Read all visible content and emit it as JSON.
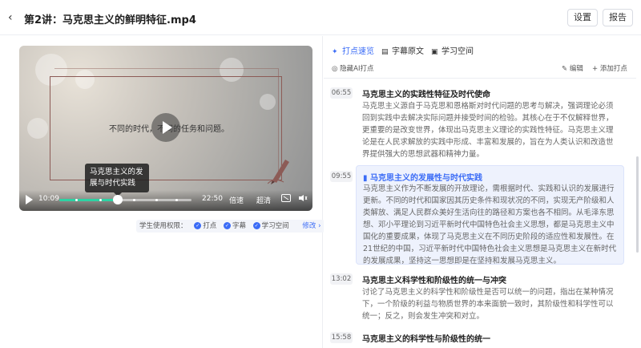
{
  "header": {
    "title": "第2讲：马克思主义的鲜明特征.mp4",
    "settings_label": "设置",
    "report_label": "报告"
  },
  "video": {
    "caption": "不同的时代，不同的任务和问题。",
    "tooltip": "马克思主义的发展与时代实践",
    "current_time": "10:09",
    "duration": "22:50",
    "speed_label": "倍速",
    "quality_label": "超清",
    "progress": 0.44
  },
  "permissions": {
    "label": "学生使用权限：",
    "items": [
      "打点",
      "字幕",
      "学习空间"
    ],
    "modify_label": "修改"
  },
  "tabs": [
    {
      "label": "打点速览",
      "icon": "sparkle-icon",
      "active": true
    },
    {
      "label": "字幕原文",
      "icon": "subtitle-icon",
      "active": false
    },
    {
      "label": "学习空间",
      "icon": "book-icon",
      "active": false
    }
  ],
  "subbar": {
    "hide_ai_label": "隐藏AI打点",
    "edit_label": "编辑",
    "add_label": "+ 添加打点"
  },
  "items": [
    {
      "time": "06:55",
      "title": "马克思主义的实践性特征及时代使命",
      "body": "马克思主义源自于马克思和恩格斯对时代问题的思考与解决，强调理论必须回到实践中去解决实际问题并接受时间的检验。其核心在于不仅解释世界，更重要的是改变世界，体现出马克思主义理论的实践性特征。马克思主义理论是在人民求解放的实践中形成、丰富和发展的，旨在为人类认识和改造世界提供强大的思想武器和精神力量。",
      "active": false
    },
    {
      "time": "09:55",
      "title": "马克思主义的发展性与时代实践",
      "body": "马克思主义作为不断发展的开放理论，需根据时代、实践和认识的发展进行更新。不同的时代和国家因其历史条件和现状况的不同，实现无产阶级和人类解放、满足人民群众美好生活向往的路径和方案也各不相同。从毛泽东思想、邓小平理论到习近平新时代中国特色社会主义思想，都是马克思主义中国化的重要成果，体现了马克思主义在不同历史阶段的适应性和发展性。在21世纪的中国，习近平新时代中国特色社会主义思想是马克思主义在新时代的发展成果，坚持这一思想即是在坚持和发展马克思主义。",
      "active": true
    },
    {
      "time": "13:02",
      "title": "马克思主义科学性和阶级性的统一与冲突",
      "body": "讨论了马克思主义的科学性和阶级性是否可以统一的问题，指出在某种情况下，一个阶级的利益与物质世界的本来面貌一致时，其阶级性和科学性可以统一；反之，则会发生冲突和对立。",
      "active": false
    },
    {
      "time": "15:58",
      "title": "马克思主义的科学性与阶级性的统一",
      "body": "",
      "active": false
    }
  ]
}
